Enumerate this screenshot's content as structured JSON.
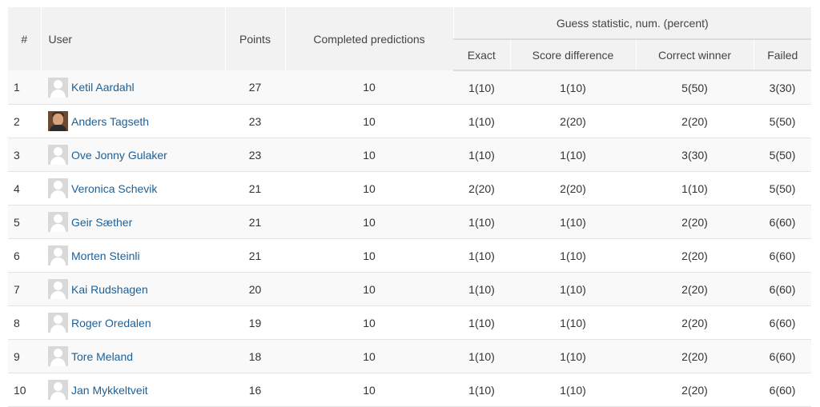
{
  "headers": {
    "rank": "#",
    "user": "User",
    "points": "Points",
    "completed": "Completed predictions",
    "guess_group": "Guess statistic, num. (percent)",
    "exact": "Exact",
    "score_difference": "Score difference",
    "correct_winner": "Correct winner",
    "failed": "Failed"
  },
  "rows": [
    {
      "rank": "1",
      "user": "Ketil Aardahl",
      "avatar": "default-avatar-icon",
      "points": "27",
      "completed": "10",
      "exact": "1(10)",
      "score_difference": "1(10)",
      "correct_winner": "5(50)",
      "failed": "3(30)"
    },
    {
      "rank": "2",
      "user": "Anders Tagseth",
      "avatar": "user-photo",
      "points": "23",
      "completed": "10",
      "exact": "1(10)",
      "score_difference": "2(20)",
      "correct_winner": "2(20)",
      "failed": "5(50)"
    },
    {
      "rank": "3",
      "user": "Ove Jonny Gulaker",
      "avatar": "default-avatar-icon",
      "points": "23",
      "completed": "10",
      "exact": "1(10)",
      "score_difference": "1(10)",
      "correct_winner": "3(30)",
      "failed": "5(50)"
    },
    {
      "rank": "4",
      "user": "Veronica Schevik",
      "avatar": "default-avatar-icon",
      "points": "21",
      "completed": "10",
      "exact": "2(20)",
      "score_difference": "2(20)",
      "correct_winner": "1(10)",
      "failed": "5(50)"
    },
    {
      "rank": "5",
      "user": "Geir Sæther",
      "avatar": "default-avatar-icon",
      "points": "21",
      "completed": "10",
      "exact": "1(10)",
      "score_difference": "1(10)",
      "correct_winner": "2(20)",
      "failed": "6(60)"
    },
    {
      "rank": "6",
      "user": "Morten Steinli",
      "avatar": "default-avatar-icon",
      "points": "21",
      "completed": "10",
      "exact": "1(10)",
      "score_difference": "1(10)",
      "correct_winner": "2(20)",
      "failed": "6(60)"
    },
    {
      "rank": "7",
      "user": "Kai Rudshagen",
      "avatar": "default-avatar-icon",
      "points": "20",
      "completed": "10",
      "exact": "1(10)",
      "score_difference": "1(10)",
      "correct_winner": "2(20)",
      "failed": "6(60)"
    },
    {
      "rank": "8",
      "user": "Roger Oredalen",
      "avatar": "default-avatar-icon",
      "points": "19",
      "completed": "10",
      "exact": "1(10)",
      "score_difference": "1(10)",
      "correct_winner": "2(20)",
      "failed": "6(60)"
    },
    {
      "rank": "9",
      "user": "Tore Meland",
      "avatar": "default-avatar-icon",
      "points": "18",
      "completed": "10",
      "exact": "1(10)",
      "score_difference": "1(10)",
      "correct_winner": "2(20)",
      "failed": "6(60)"
    },
    {
      "rank": "10",
      "user": "Jan Mykkeltveit",
      "avatar": "default-avatar-icon",
      "points": "16",
      "completed": "10",
      "exact": "1(10)",
      "score_difference": "1(10)",
      "correct_winner": "2(20)",
      "failed": "6(60)"
    }
  ],
  "colors": {
    "link": "#1f5f94",
    "header_bg": "#f2f2f2",
    "stripe": "#f9f9f9"
  }
}
